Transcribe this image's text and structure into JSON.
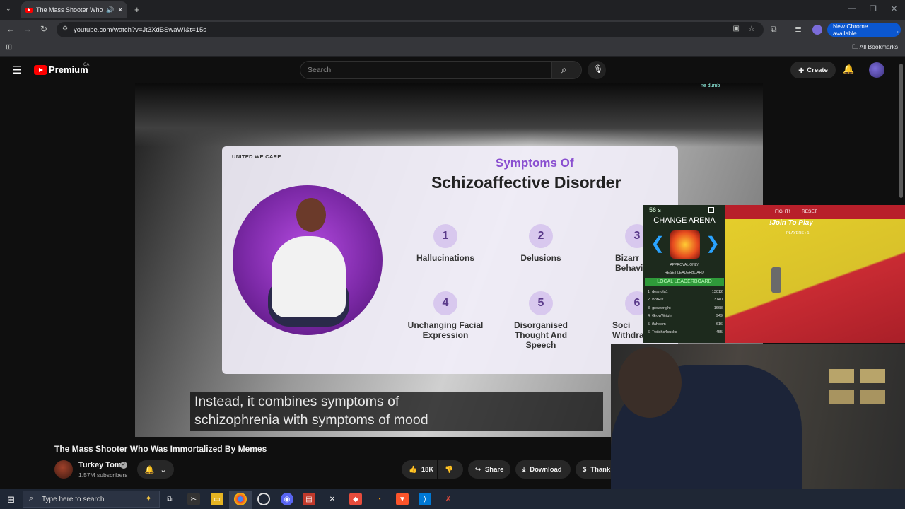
{
  "browser": {
    "tab_title": "The Mass Shooter Who Wa",
    "url": "youtube.com/watch?v=Jt3XdBSwaWI&t=15s",
    "new_chrome": "New Chrome available",
    "all_bookmarks": "All Bookmarks"
  },
  "youtube": {
    "logo": "Premium",
    "region": "CA",
    "search_placeholder": "Search",
    "create": "Create"
  },
  "video": {
    "slide_brand": "UNITED WE CARE",
    "slide_title_1": "Symptoms Of",
    "slide_title_2": "Schizoaffective Disorder",
    "symptoms": [
      {
        "num": "1",
        "label": "Hallucinations"
      },
      {
        "num": "2",
        "label": "Delusions"
      },
      {
        "num": "3",
        "label": "Bizarr Behavi"
      },
      {
        "num": "4",
        "label": "Unchanging Facial Expression"
      },
      {
        "num": "5",
        "label": "Disorganised Thought And Speech"
      },
      {
        "num": "6",
        "label": "Soci Withdra"
      }
    ],
    "caption_line_1": "Instead, it combines symptoms of",
    "caption_line_2": "schizophrenia with symptoms of mood",
    "overlay_tag": "ne dumb"
  },
  "game": {
    "timer": "56 s",
    "change_arena": "CHANGE ARENA",
    "approval": "APPROVAL ONLY",
    "reset_lb": "RESET LEADERBOARD",
    "local_lb": "LOCAL LEADERBOARD",
    "fight": "FIGHT!",
    "reset": "RESET",
    "join": "!Join To Play",
    "players": "PLAYERS : 1",
    "leaderboard": [
      {
        "name": "1. dearlola1",
        "score": "13012"
      },
      {
        "name": "2. BotRix",
        "score": "3140"
      },
      {
        "name": "3. growwright",
        "score": "1668"
      },
      {
        "name": "4. GrowWright",
        "score": "949"
      },
      {
        "name": "5. ifaheem",
        "score": "616"
      },
      {
        "name": "6. Twitchs4cucks",
        "score": "455"
      }
    ]
  },
  "meta": {
    "title": "The Mass Shooter Who Was Immortalized By Memes",
    "channel": "Turkey Tom",
    "subscribers": "1.57M subscribers",
    "likes": "18K",
    "share": "Share",
    "download": "Download",
    "thanks": "Thank"
  },
  "taskbar": {
    "search_placeholder": "Type here to search"
  }
}
